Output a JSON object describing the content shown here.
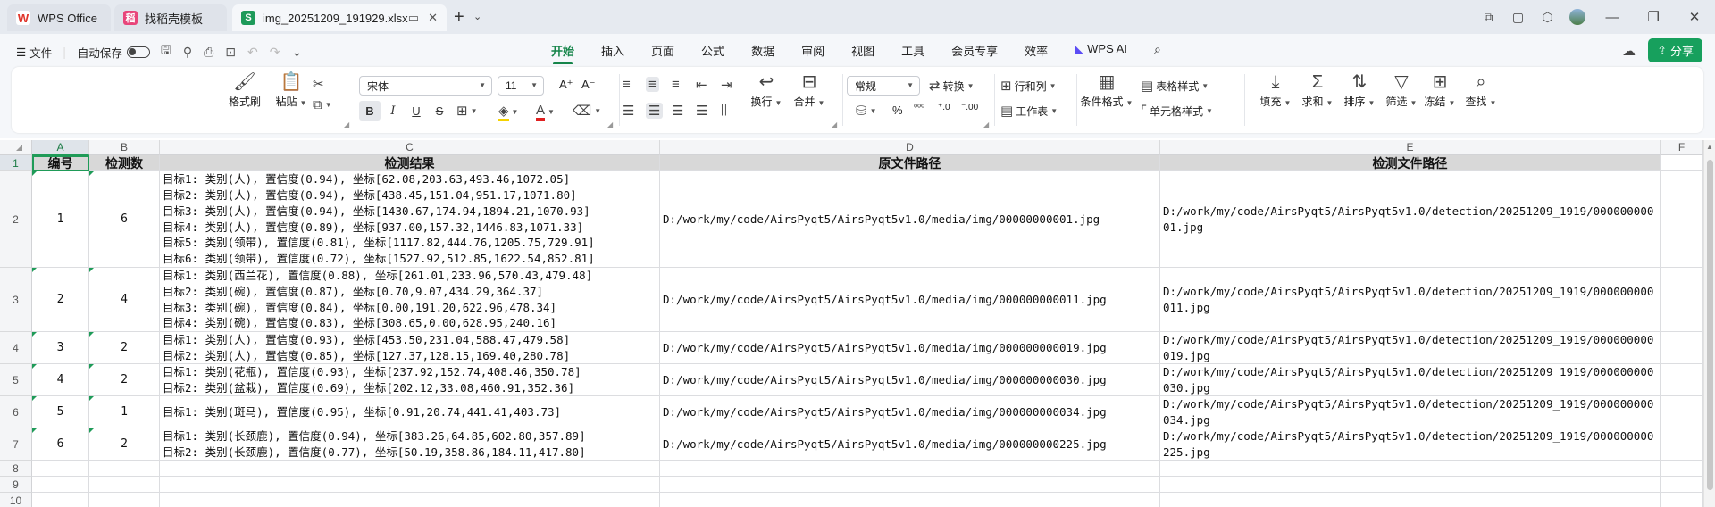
{
  "tabs": [
    {
      "label": "WPS Office",
      "icon": "wps-logo-icon"
    },
    {
      "label": "找稻壳模板",
      "icon": "docer-icon"
    },
    {
      "label": "img_20251209_191929.xlsx",
      "icon": "spreadsheet-icon"
    }
  ],
  "menubar": {
    "file": "文件",
    "autosave": "自动保存",
    "tabs": [
      "开始",
      "插入",
      "页面",
      "公式",
      "数据",
      "审阅",
      "视图",
      "工具",
      "会员专享",
      "效率",
      "WPS AI"
    ],
    "active_tab": "开始",
    "share": "分享"
  },
  "ribbon": {
    "format_painter": "格式刷",
    "paste": "粘贴",
    "font_name": "宋体",
    "font_size": "11",
    "number_format": "常规",
    "convert": "转换",
    "rows_cols": "行和列",
    "worksheet": "工作表",
    "wrap": "换行",
    "merge": "合并",
    "conditional_format": "条件格式",
    "table_style": "表格样式",
    "cell_style": "单元格样式",
    "fill": "填充",
    "sum": "求和",
    "sort": "排序",
    "filter": "筛选",
    "freeze": "冻结",
    "find": "查找",
    "percent": "%",
    "bold": "B",
    "italic": "I",
    "underline": "U",
    "strike": "S"
  },
  "sheet": {
    "columns": [
      "A",
      "B",
      "C",
      "D",
      "E",
      "F"
    ],
    "row_numbers": [
      "1",
      "2",
      "3",
      "4",
      "5",
      "6",
      "7",
      "8",
      "9",
      "10"
    ],
    "headers": [
      "编号",
      "检测数",
      "检测结果",
      "原文件路径",
      "检测文件路径"
    ],
    "rows": [
      {
        "id": "1",
        "count": "6",
        "results": [
          "目标1: 类别(人), 置信度(0.94), 坐标[62.08,203.63,493.46,1072.05]",
          "目标2: 类别(人), 置信度(0.94), 坐标[438.45,151.04,951.17,1071.80]",
          "目标3: 类别(人), 置信度(0.94), 坐标[1430.67,174.94,1894.21,1070.93]",
          "目标4: 类别(人), 置信度(0.89), 坐标[937.00,157.32,1446.83,1071.33]",
          "目标5: 类别(领带), 置信度(0.81), 坐标[1117.82,444.76,1205.75,729.91]",
          "目标6: 类别(领带), 置信度(0.72), 坐标[1527.92,512.85,1622.54,852.81]"
        ],
        "src": "D:/work/my/code/AirsPyqt5/AirsPyqt5v1.0/media/img/00000000001.jpg",
        "det": "D:/work/my/code/AirsPyqt5/AirsPyqt5v1.0/detection/20251209_1919/00000000001.jpg"
      },
      {
        "id": "2",
        "count": "4",
        "results": [
          "目标1: 类别(西兰花), 置信度(0.88), 坐标[261.01,233.96,570.43,479.48]",
          "目标2: 类别(碗), 置信度(0.87), 坐标[0.70,9.07,434.29,364.37]",
          "目标3: 类别(碗), 置信度(0.84), 坐标[0.00,191.20,622.96,478.34]",
          "目标4: 类别(碗), 置信度(0.83), 坐标[308.65,0.00,628.95,240.16]"
        ],
        "src": "D:/work/my/code/AirsPyqt5/AirsPyqt5v1.0/media/img/000000000011.jpg",
        "det": "D:/work/my/code/AirsPyqt5/AirsPyqt5v1.0/detection/20251209_1919/000000000011.jpg"
      },
      {
        "id": "3",
        "count": "2",
        "results": [
          "目标1: 类别(人), 置信度(0.93), 坐标[453.50,231.04,588.47,479.58]",
          "目标2: 类别(人), 置信度(0.85), 坐标[127.37,128.15,169.40,280.78]"
        ],
        "src": "D:/work/my/code/AirsPyqt5/AirsPyqt5v1.0/media/img/000000000019.jpg",
        "det": "D:/work/my/code/AirsPyqt5/AirsPyqt5v1.0/detection/20251209_1919/000000000019.jpg"
      },
      {
        "id": "4",
        "count": "2",
        "results": [
          "目标1: 类别(花瓶), 置信度(0.93), 坐标[237.92,152.74,408.46,350.78]",
          "目标2: 类别(盆栽), 置信度(0.69), 坐标[202.12,33.08,460.91,352.36]"
        ],
        "src": "D:/work/my/code/AirsPyqt5/AirsPyqt5v1.0/media/img/000000000030.jpg",
        "det": "D:/work/my/code/AirsPyqt5/AirsPyqt5v1.0/detection/20251209_1919/000000000030.jpg"
      },
      {
        "id": "5",
        "count": "1",
        "results": [
          "目标1: 类别(斑马), 置信度(0.95), 坐标[0.91,20.74,441.41,403.73]"
        ],
        "src": "D:/work/my/code/AirsPyqt5/AirsPyqt5v1.0/media/img/000000000034.jpg",
        "det": "D:/work/my/code/AirsPyqt5/AirsPyqt5v1.0/detection/20251209_1919/000000000034.jpg"
      },
      {
        "id": "6",
        "count": "2",
        "results": [
          "目标1: 类别(长颈鹿), 置信度(0.94), 坐标[383.26,64.85,602.80,357.89]",
          "目标2: 类别(长颈鹿), 置信度(0.77), 坐标[50.19,358.86,184.11,417.80]"
        ],
        "src": "D:/work/my/code/AirsPyqt5/AirsPyqt5v1.0/media/img/000000000225.jpg",
        "det": "D:/work/my/code/AirsPyqt5/AirsPyqt5v1.0/detection/20251209_1919/000000000225.jpg"
      }
    ]
  },
  "colors": {
    "accent": "#16854a",
    "share_bg": "#17a05d",
    "header_fill": "#d8d8d8"
  }
}
